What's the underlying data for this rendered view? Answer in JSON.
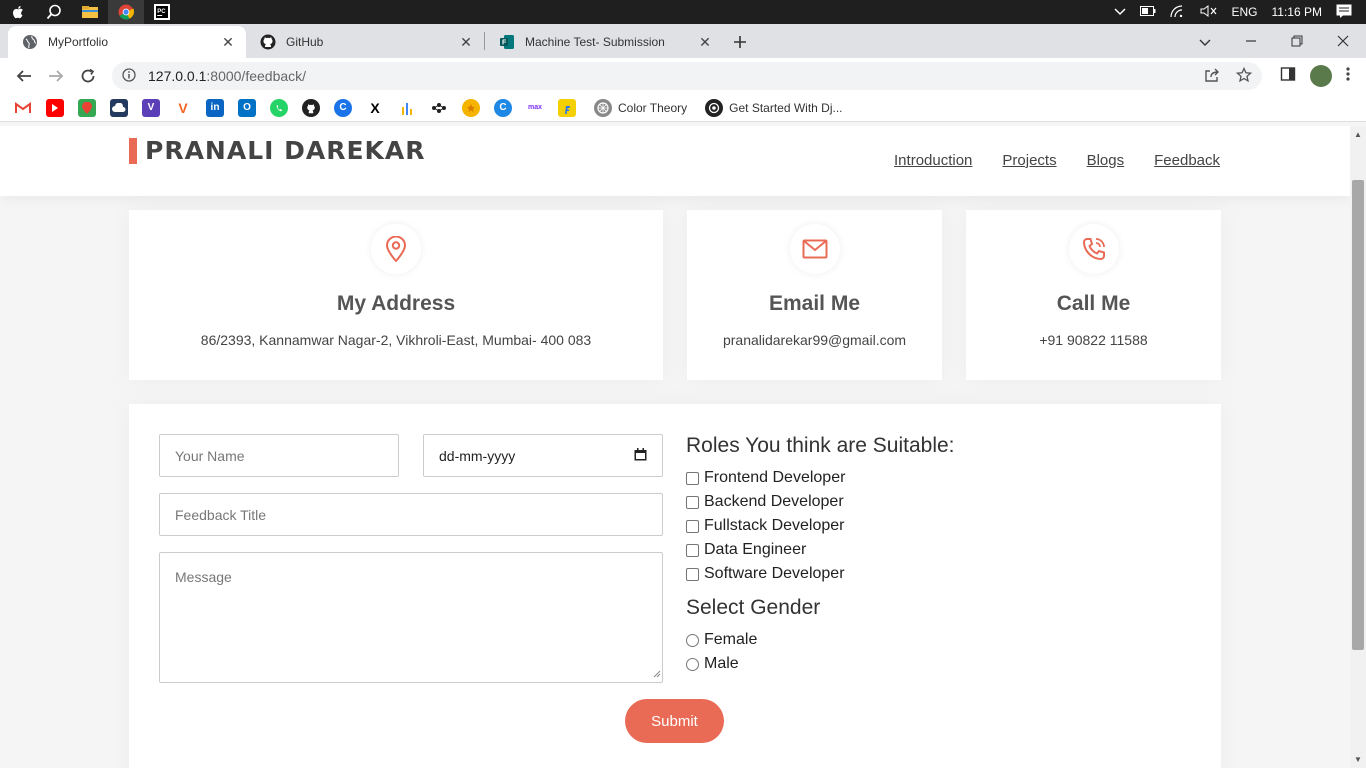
{
  "os": {
    "language": "ENG",
    "time": "11:16 PM"
  },
  "browser": {
    "tabs": [
      {
        "title": "MyPortfolio",
        "active": true
      },
      {
        "title": "GitHub",
        "active": false
      },
      {
        "title": "Machine Test- Submission",
        "active": false
      }
    ],
    "url_host": "127.0.0.1",
    "url_path": ":8000/feedback/",
    "bookmarks_named": [
      {
        "label": "Color Theory"
      },
      {
        "label": "Get Started With Dj..."
      }
    ]
  },
  "site": {
    "brand": "PRANALI DAREKAR",
    "nav": [
      "Introduction",
      "Projects",
      "Blogs",
      "Feedback"
    ],
    "contact_cards": [
      {
        "icon": "map-pin-icon",
        "title": "My Address",
        "text": "86/2393, Kannamwar Nagar-2, Vikhroli-East, Mumbai- 400 083"
      },
      {
        "icon": "envelope-icon",
        "title": "Email Me",
        "text": "pranalidarekar99@gmail.com"
      },
      {
        "icon": "phone-icon",
        "title": "Call Me",
        "text": "+91 90822 11588"
      }
    ],
    "form": {
      "name_placeholder": "Your Name",
      "date_placeholder": "dd-mm-yyyy",
      "title_placeholder": "Feedback Title",
      "message_placeholder": "Message",
      "roles_title": "Roles You think are Suitable:",
      "roles": [
        "Frontend Developer",
        "Backend Developer",
        "Fullstack Developer",
        "Data Engineer",
        "Software Developer"
      ],
      "gender_title": "Select Gender",
      "genders": [
        "Female",
        "Male"
      ],
      "submit_label": "Submit"
    }
  },
  "colors": {
    "accent": "#e96b56",
    "os_bar": "#1f1f1f",
    "tabstrip": "#dfe1e5"
  }
}
